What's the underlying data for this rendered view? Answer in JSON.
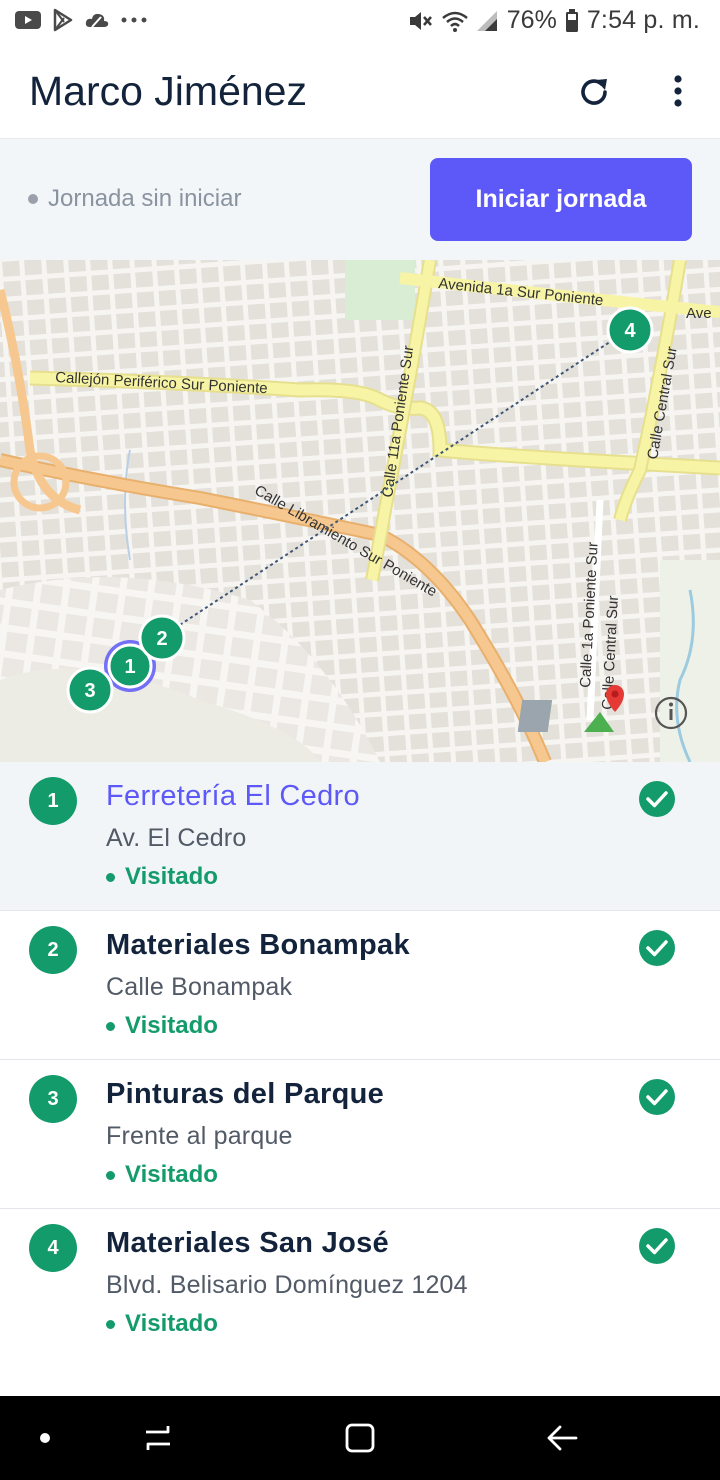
{
  "status_bar": {
    "battery": "76%",
    "time": "7:54 p. m."
  },
  "header": {
    "title": "Marco Jiménez"
  },
  "journey": {
    "status": "Jornada sin iniciar",
    "start_label": "Iniciar jornada"
  },
  "map": {
    "streets": [
      "Avenida 1a Sur Poniente",
      "Ave",
      "Callejón Periférico Sur Poniente",
      "Calle 11a Poniente Sur",
      "Calle Central Sur",
      "Calle Libramiento Sur Poniente",
      "Calle 1a Poniente Sur",
      "Calle Central Sur"
    ],
    "markers": [
      "1",
      "2",
      "3",
      "4"
    ]
  },
  "stops": [
    {
      "number": "1",
      "name": "Ferretería El Cedro",
      "address": "Av. El Cedro",
      "status": "Visitado"
    },
    {
      "number": "2",
      "name": "Materiales Bonampak",
      "address": "Calle Bonampak",
      "status": "Visitado"
    },
    {
      "number": "3",
      "name": "Pinturas del Parque",
      "address": "Frente al parque",
      "status": "Visitado"
    },
    {
      "number": "4",
      "name": "Materiales San José",
      "address": "Blvd. Belisario Domínguez 1204",
      "status": "Visitado"
    }
  ],
  "colors": {
    "accent": "#5d58f8",
    "success": "#149b6b",
    "title": "#13233b"
  }
}
